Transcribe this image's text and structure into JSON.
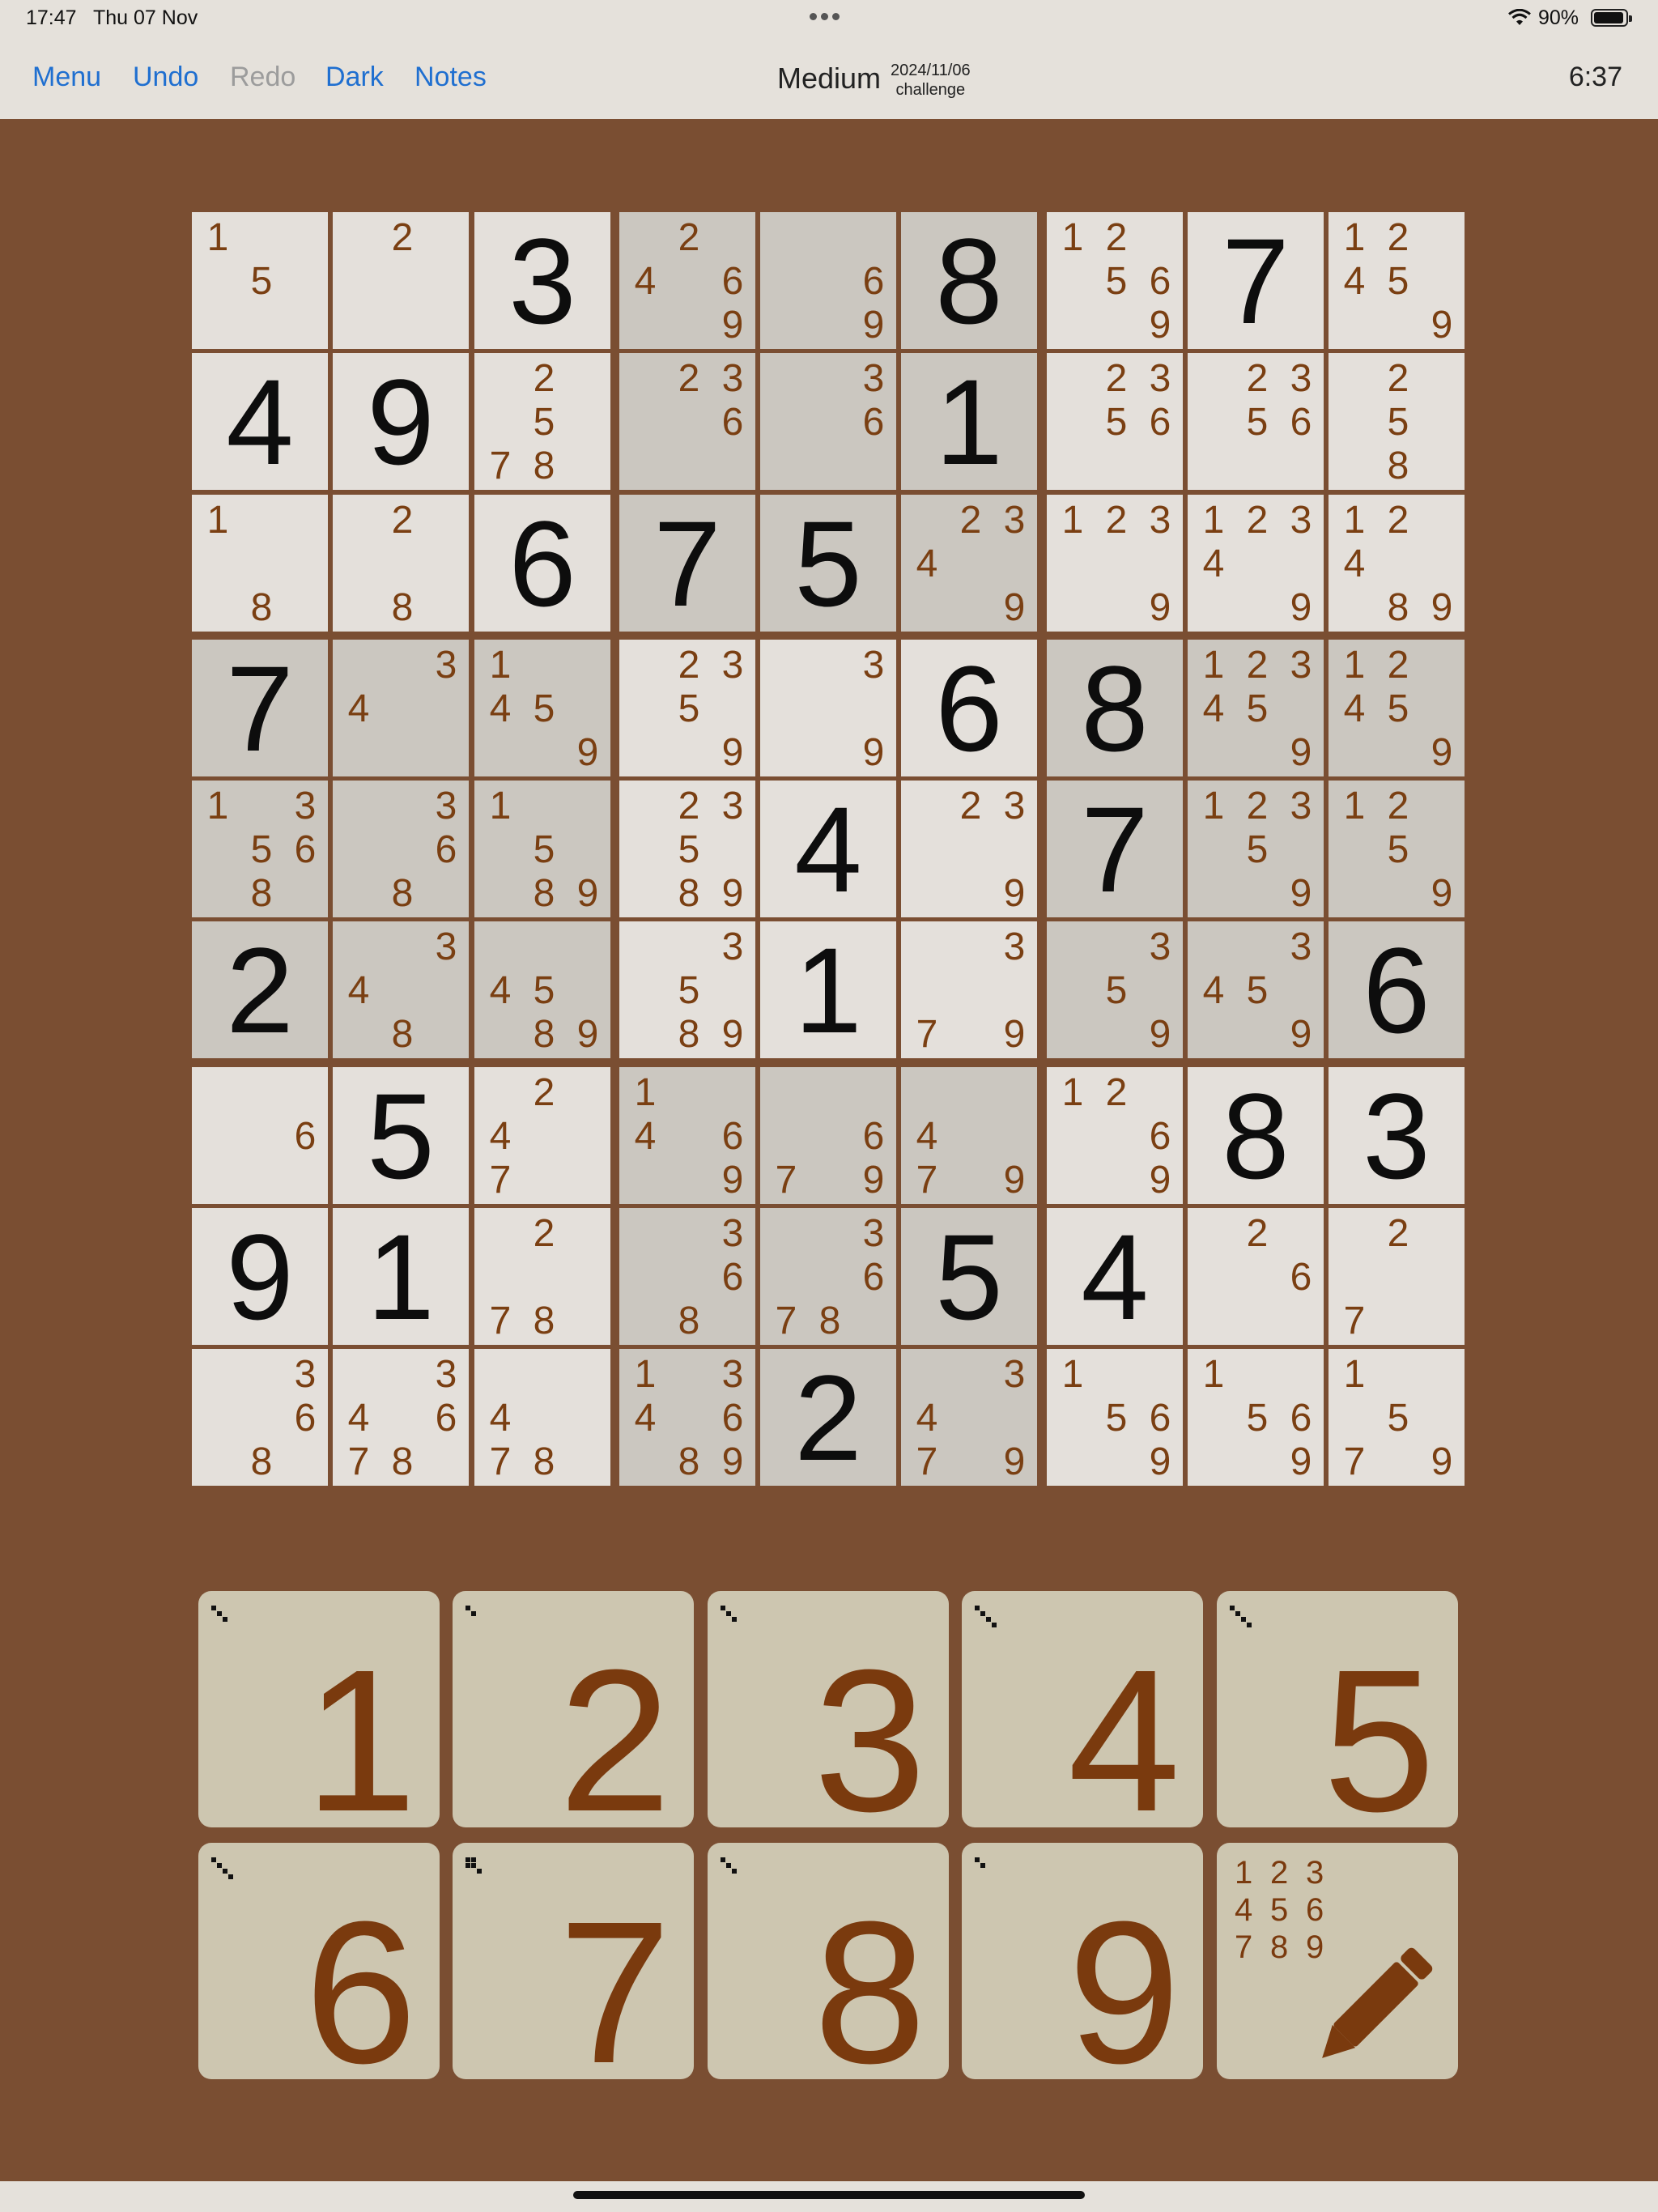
{
  "status": {
    "time": "17:47",
    "date": "Thu 07 Nov",
    "battery": "90%"
  },
  "nav": {
    "menu": "Menu",
    "undo": "Undo",
    "redo": "Redo",
    "dark": "Dark",
    "notes": "Notes",
    "difficulty": "Medium",
    "puzzle_date": "2024/11/06",
    "puzzle_type": "challenge",
    "timer": "6:37"
  },
  "board": {
    "rows": [
      [
        {
          "n": [
            1,
            5
          ]
        },
        {
          "n": [
            2
          ]
        },
        {
          "v": 3
        },
        {
          "n": [
            2,
            4,
            6,
            9
          ]
        },
        {
          "n": [
            6,
            9
          ]
        },
        {
          "v": 8
        },
        {
          "n": [
            1,
            2,
            5,
            6,
            9
          ]
        },
        {
          "v": 7
        },
        {
          "n": [
            1,
            2,
            4,
            5,
            9
          ]
        }
      ],
      [
        {
          "v": 4
        },
        {
          "v": 9
        },
        {
          "n": [
            2,
            5,
            7,
            8
          ]
        },
        {
          "n": [
            2,
            3,
            6
          ]
        },
        {
          "n": [
            3,
            6
          ]
        },
        {
          "v": 1
        },
        {
          "n": [
            2,
            3,
            5,
            6
          ]
        },
        {
          "n": [
            2,
            3,
            5,
            6
          ]
        },
        {
          "n": [
            2,
            5,
            8
          ]
        }
      ],
      [
        {
          "n": [
            1,
            8
          ]
        },
        {
          "n": [
            2,
            8
          ]
        },
        {
          "v": 6
        },
        {
          "v": 7
        },
        {
          "v": 5
        },
        {
          "n": [
            2,
            3,
            4,
            9
          ]
        },
        {
          "n": [
            1,
            2,
            3,
            9
          ]
        },
        {
          "n": [
            1,
            2,
            3,
            4,
            9
          ]
        },
        {
          "n": [
            1,
            2,
            4,
            8,
            9
          ]
        }
      ],
      [
        {
          "v": 7
        },
        {
          "n": [
            3,
            4
          ]
        },
        {
          "n": [
            1,
            4,
            5,
            9
          ]
        },
        {
          "n": [
            2,
            3,
            5,
            9
          ]
        },
        {
          "n": [
            3,
            9
          ]
        },
        {
          "v": 6
        },
        {
          "v": 8
        },
        {
          "n": [
            1,
            2,
            3,
            4,
            5,
            9
          ]
        },
        {
          "n": [
            1,
            2,
            4,
            5,
            9
          ]
        }
      ],
      [
        {
          "n": [
            1,
            3,
            5,
            6,
            8
          ]
        },
        {
          "n": [
            3,
            6,
            8
          ]
        },
        {
          "n": [
            1,
            5,
            8,
            9
          ]
        },
        {
          "n": [
            2,
            3,
            5,
            8,
            9
          ]
        },
        {
          "v": 4
        },
        {
          "n": [
            2,
            3,
            9
          ]
        },
        {
          "v": 7
        },
        {
          "n": [
            1,
            2,
            3,
            5,
            9
          ]
        },
        {
          "n": [
            1,
            2,
            5,
            9
          ]
        }
      ],
      [
        {
          "v": 2
        },
        {
          "n": [
            3,
            4,
            8
          ]
        },
        {
          "n": [
            4,
            5,
            8,
            9
          ]
        },
        {
          "n": [
            3,
            5,
            8,
            9
          ]
        },
        {
          "v": 1
        },
        {
          "n": [
            3,
            7,
            9
          ]
        },
        {
          "n": [
            3,
            5,
            9
          ]
        },
        {
          "n": [
            3,
            4,
            5,
            9
          ]
        },
        {
          "v": 6
        }
      ],
      [
        {
          "n": [
            6
          ]
        },
        {
          "v": 5
        },
        {
          "n": [
            2,
            4,
            7
          ]
        },
        {
          "n": [
            1,
            4,
            6,
            9
          ]
        },
        {
          "n": [
            6,
            7,
            9
          ]
        },
        {
          "n": [
            4,
            7,
            9
          ]
        },
        {
          "n": [
            1,
            2,
            6,
            9
          ]
        },
        {
          "v": 8
        },
        {
          "v": 3
        }
      ],
      [
        {
          "v": 9
        },
        {
          "v": 1
        },
        {
          "n": [
            2,
            7,
            8
          ]
        },
        {
          "n": [
            3,
            6,
            8
          ]
        },
        {
          "n": [
            3,
            6,
            7,
            8
          ]
        },
        {
          "v": 5
        },
        {
          "v": 4
        },
        {
          "n": [
            2,
            6
          ]
        },
        {
          "n": [
            2,
            7
          ]
        }
      ],
      [
        {
          "n": [
            3,
            6,
            8
          ]
        },
        {
          "n": [
            3,
            4,
            6,
            7,
            8
          ]
        },
        {
          "n": [
            4,
            7,
            8
          ]
        },
        {
          "n": [
            1,
            3,
            4,
            6,
            8,
            9
          ]
        },
        {
          "v": 2
        },
        {
          "n": [
            3,
            4,
            7,
            9
          ]
        },
        {
          "n": [
            1,
            5,
            6,
            9
          ]
        },
        {
          "n": [
            1,
            5,
            6,
            9
          ]
        },
        {
          "n": [
            1,
            5,
            7,
            9
          ]
        }
      ]
    ],
    "shaded": [
      [
        0,
        0,
        0,
        1,
        1,
        1,
        0,
        0,
        0
      ],
      [
        0,
        0,
        0,
        1,
        1,
        1,
        0,
        0,
        0
      ],
      [
        0,
        0,
        0,
        1,
        1,
        1,
        0,
        0,
        0
      ],
      [
        1,
        1,
        1,
        0,
        0,
        0,
        1,
        1,
        1
      ],
      [
        1,
        1,
        1,
        0,
        0,
        0,
        1,
        1,
        1
      ],
      [
        1,
        1,
        1,
        0,
        0,
        0,
        1,
        1,
        1
      ],
      [
        0,
        0,
        0,
        1,
        1,
        1,
        0,
        0,
        0
      ],
      [
        0,
        0,
        0,
        1,
        1,
        1,
        0,
        0,
        0
      ],
      [
        0,
        0,
        0,
        1,
        1,
        1,
        0,
        0,
        0
      ]
    ]
  },
  "keypad": {
    "keys": [
      {
        "label": "1",
        "placed": 3
      },
      {
        "label": "2",
        "placed": 2
      },
      {
        "label": "3",
        "placed": 3
      },
      {
        "label": "4",
        "placed": 4
      },
      {
        "label": "5",
        "placed": 4
      },
      {
        "label": "6",
        "placed": 4
      },
      {
        "label": "7",
        "placed": 5
      },
      {
        "label": "8",
        "placed": 3
      },
      {
        "label": "9",
        "placed": 2
      }
    ],
    "notes_key": {
      "mini_digits": [
        "1",
        "2",
        "3",
        "4",
        "5",
        "6",
        "7",
        "8",
        "9"
      ],
      "icon": "pencil-icon"
    }
  },
  "colors": {
    "background": "#7a4e32",
    "cell_light": "#e4e0db",
    "cell_shaded": "#cbc7c0",
    "note_color": "#7a3f12",
    "key_bg": "#cdc6b0",
    "link_blue": "#1f6fd0"
  }
}
